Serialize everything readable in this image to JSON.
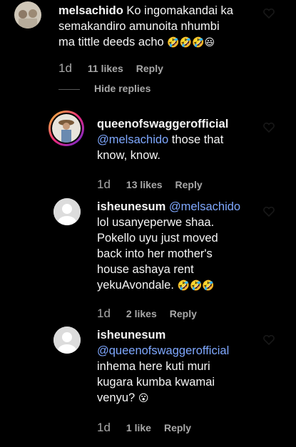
{
  "comments": [
    {
      "username": "melsachido",
      "text_lines": [
        "Ko ingomakandai ka",
        "semakandiro amunoita nhumbi",
        "ma tittle deeds acho"
      ],
      "emojis": "🤣🤣🤣😃",
      "time": "1d",
      "likes": "11 likes",
      "reply": "Reply"
    },
    {
      "username": "queenofswaggerofficial",
      "mention": "@melsachido",
      "text_after_mention": " those that",
      "text_lines": [
        "know, know."
      ],
      "time": "1d",
      "likes": "13 likes",
      "reply": "Reply"
    },
    {
      "username": "isheunesum",
      "mention": "@melsachido",
      "text_lines": [
        "lol usanyeperwe shaa.",
        "Pokello uyu just moved",
        "back into her mother's",
        "house ashaya rent",
        "yekuAvondale."
      ],
      "emojis": "🤣🤣🤣",
      "time": "1d",
      "likes": "2 likes",
      "reply": "Reply"
    },
    {
      "username": "isheunesum",
      "mention": "@queenofswaggerofficial",
      "text_lines": [
        "inhema here kuti muri",
        "kugara kumba kwamai",
        "venyu?"
      ],
      "emojis": "😮",
      "time": "1d",
      "likes": "1 like",
      "reply": "Reply"
    }
  ],
  "hide_replies": "Hide replies",
  "colors": {
    "background": "#000000",
    "text": "#f5f5f5",
    "muted": "#a8a8a8",
    "mention": "#7fa8ff"
  }
}
